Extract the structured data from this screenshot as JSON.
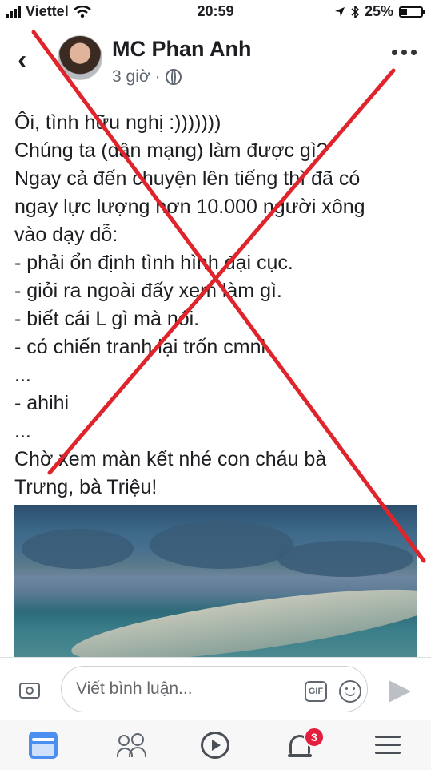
{
  "status_bar": {
    "carrier": "Viettel",
    "time": "20:59",
    "battery": "25%",
    "battery_fraction": 0.25
  },
  "post": {
    "author": "MC Phan Anh",
    "time_ago": "3 giờ",
    "separator": "·",
    "privacy_icon": "globe-icon",
    "lines": [
      "Ôi, tình hữu nghị :)))))))",
      "Chúng ta (dân mạng) làm được gì?",
      "Ngay cả đến chuyện lên tiếng thì đã có",
      "ngay lực lượng hơn 10.000 người xông",
      "vào dạy dỗ:",
      "- phải ổn định tình hình đại cục.",
      "- giỏi ra ngoài đấy xem làm gì.",
      "- biết cái L gì mà nói.",
      "- có chiến tranh lại trốn cmnl.",
      "...",
      "- ahihi",
      "...",
      "Chờ xem màn kết nhé con cháu bà",
      "Trưng, bà Triệu!"
    ]
  },
  "comment_bar": {
    "placeholder": "Viết bình luận...",
    "gif_label": "GIF"
  },
  "tab_bar": {
    "notifications_badge": "3"
  },
  "colors": {
    "cross": "#e0242b",
    "accent": "#4b8ff0",
    "badge": "#e41e3f"
  }
}
